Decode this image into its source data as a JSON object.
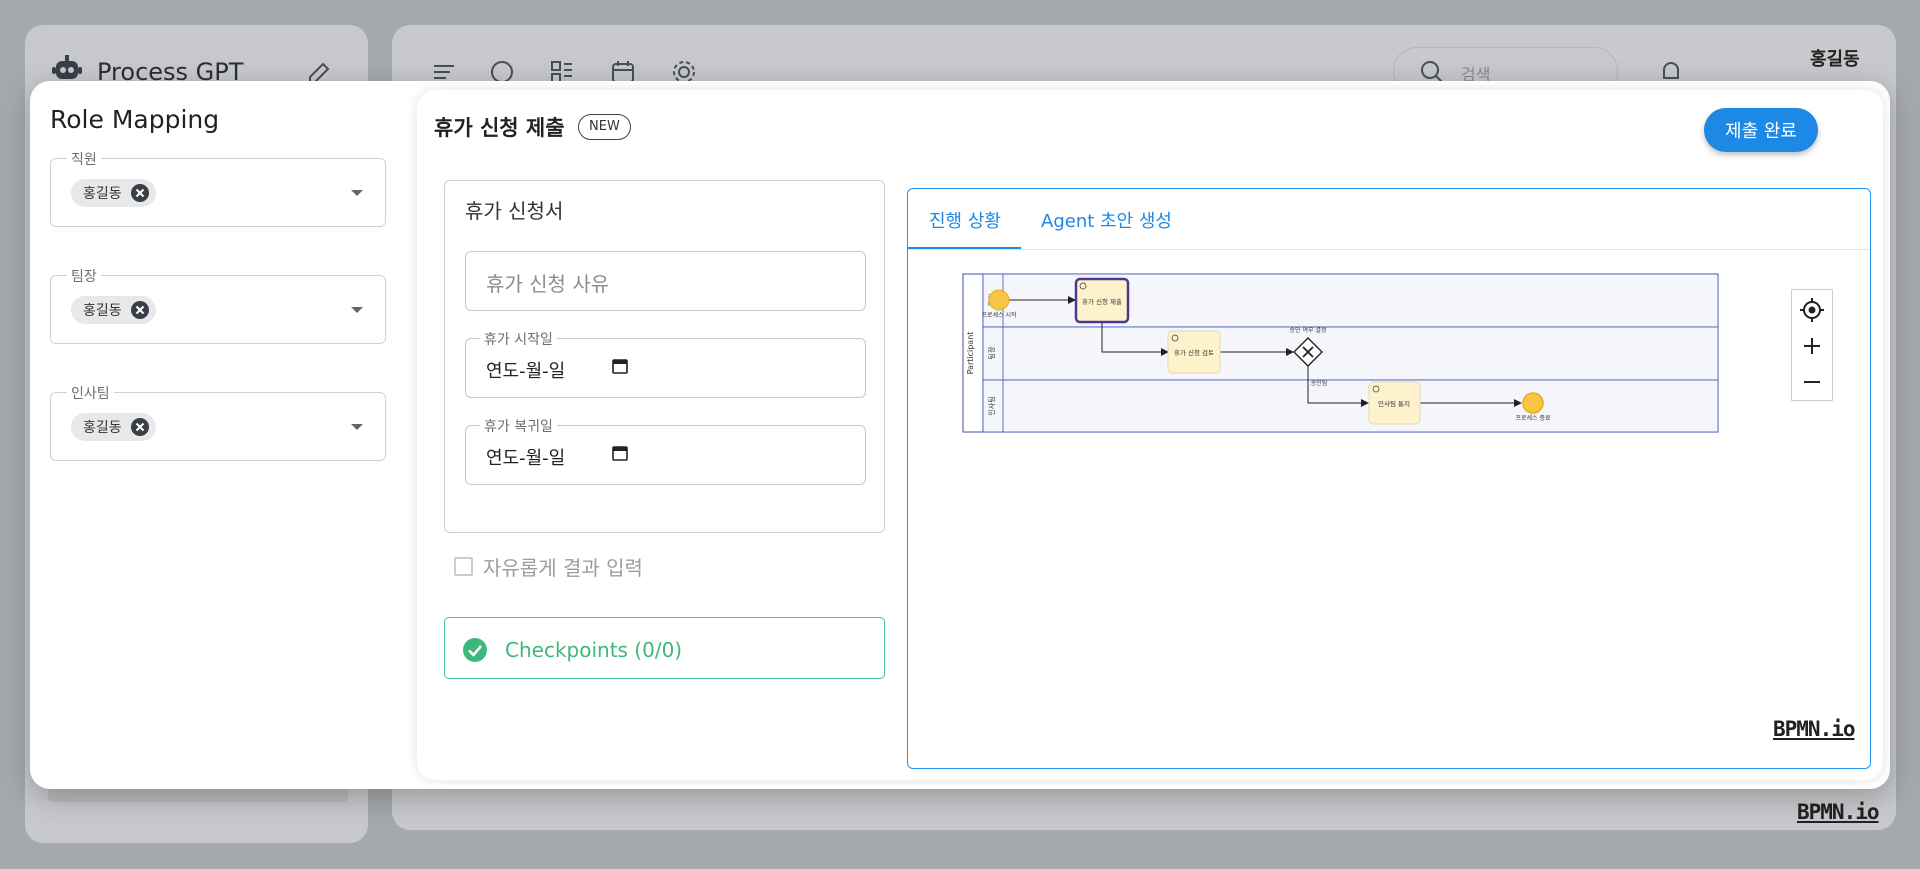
{
  "background": {
    "app_title": "Process GPT",
    "search_placeholder": "검색",
    "user_name": "홍길동",
    "bpmn_logo": "BPMN.io"
  },
  "role_mapping": {
    "title": "Role Mapping",
    "roles": [
      {
        "label": "직원",
        "assignee": "홍길동"
      },
      {
        "label": "팀장",
        "assignee": "홍길동"
      },
      {
        "label": "인사팀",
        "assignee": "홍길동"
      }
    ]
  },
  "form": {
    "title": "휴가 신청 제출",
    "badge": "NEW",
    "submit_label": "제출 완료",
    "card_title": "휴가 신청서",
    "reason_placeholder": "휴가 신청 사유",
    "start_label": "휴가 시작일",
    "start_value": "연도-월-일",
    "return_label": "휴가 복귀일",
    "return_value": "연도-월-일",
    "free_input_label": "자유롭게 결과 입력",
    "checkpoints_label": "Checkpoints (0/0)"
  },
  "diagram": {
    "tabs": [
      "진행 상황",
      "Agent 초안 생성"
    ],
    "active_tab": 0,
    "bpmn_logo": "BPMN.io",
    "pool_label": "Participant",
    "lanes": [
      "직원",
      "팀장",
      "인사팀"
    ],
    "nodes": {
      "start": "프로세스 시작",
      "task1": "휴가 신청 제출",
      "task2": "휴가 신청 검토",
      "gateway": "승인 여부 결정",
      "flow_label": "승인됨",
      "task3": "인사팀 통지",
      "end": "프로세스 종료"
    },
    "colors": {
      "task_fill": "#fdf2cc",
      "event_fill": "#f7c646",
      "active_stroke": "#4b3a8c",
      "lane_fill": "#f5f6fb",
      "pool_stroke": "#3b4fb8"
    }
  }
}
